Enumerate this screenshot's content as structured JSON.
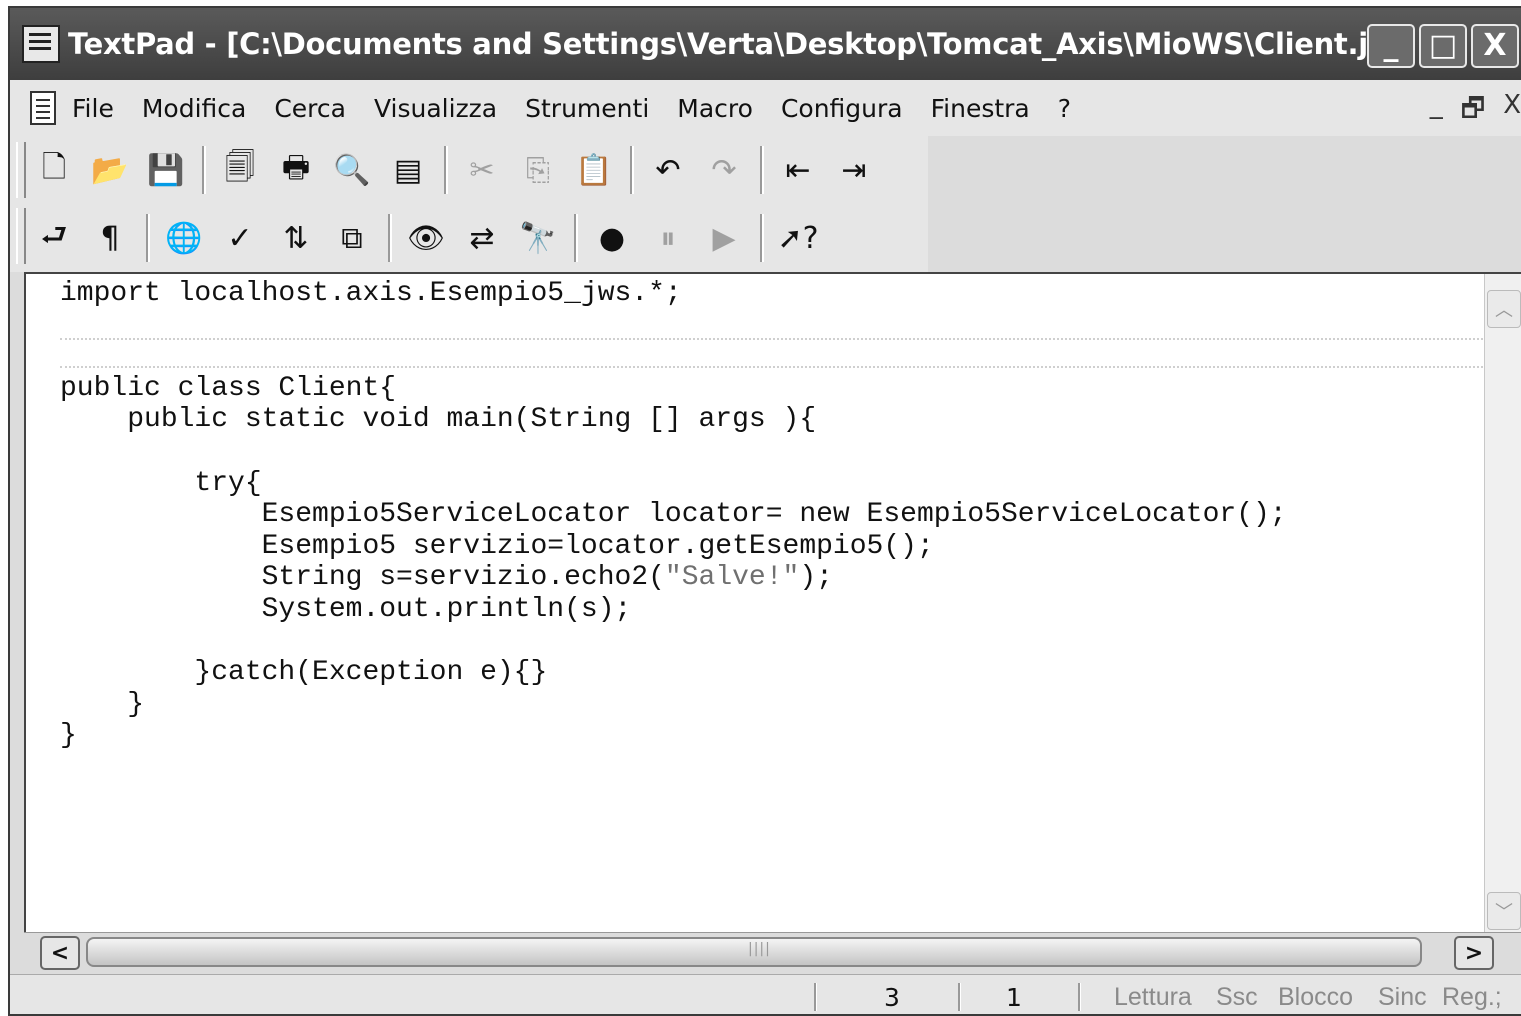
{
  "window": {
    "title": "TextPad - [C:\\Documents and Settings\\Verta\\Desktop\\Tomcat_Axis\\MioWS\\Client.j...",
    "buttons": [
      "_",
      "□",
      "X"
    ]
  },
  "menu": {
    "items": [
      "File",
      "Modifica",
      "Cerca",
      "Visualizza",
      "Strumenti",
      "Macro",
      "Configura",
      "Finestra",
      "?"
    ],
    "mdi_buttons": [
      "_",
      "🗗",
      "X"
    ]
  },
  "toolbar": {
    "row1": [
      {
        "name": "new-file-icon",
        "glyph": "🗋"
      },
      {
        "name": "open-folder-icon",
        "glyph": "📂"
      },
      {
        "name": "save-icon",
        "glyph": "💾",
        "disabled": true
      },
      {
        "sep": true
      },
      {
        "name": "document-properties-icon",
        "glyph": "🗐"
      },
      {
        "name": "print-icon",
        "glyph": "🖶"
      },
      {
        "name": "print-preview-icon",
        "glyph": "🔍"
      },
      {
        "name": "page-setup-icon",
        "glyph": "▤"
      },
      {
        "sep": true
      },
      {
        "name": "cut-icon",
        "glyph": "✂",
        "disabled": true
      },
      {
        "name": "copy-icon",
        "glyph": "⎘",
        "disabled": true
      },
      {
        "name": "paste-icon",
        "glyph": "📋"
      },
      {
        "sep": true
      },
      {
        "name": "undo-icon",
        "glyph": "↶"
      },
      {
        "name": "redo-icon",
        "glyph": "↷",
        "disabled": true
      },
      {
        "sep": true
      },
      {
        "name": "outdent-icon",
        "glyph": "⇤"
      },
      {
        "name": "indent-icon",
        "glyph": "⇥"
      }
    ],
    "row2": [
      {
        "name": "word-wrap-icon",
        "glyph": "⮐"
      },
      {
        "name": "paragraph-icon",
        "glyph": "¶"
      },
      {
        "sep": true
      },
      {
        "name": "web-browser-icon",
        "glyph": "🌐"
      },
      {
        "name": "spell-check-icon",
        "glyph": "✓"
      },
      {
        "name": "sort-icon",
        "glyph": "⇅"
      },
      {
        "name": "compare-icon",
        "glyph": "⧉"
      },
      {
        "sep": true
      },
      {
        "name": "find-icon",
        "glyph": "👁"
      },
      {
        "name": "replace-icon",
        "glyph": "⇄"
      },
      {
        "name": "find-in-files-icon",
        "glyph": "🔭"
      },
      {
        "sep": true
      },
      {
        "name": "record-macro-icon",
        "glyph": "●"
      },
      {
        "name": "pause-macro-icon",
        "glyph": "⏸",
        "disabled": true
      },
      {
        "name": "play-macro-icon",
        "glyph": "▶",
        "disabled": true
      },
      {
        "sep": true
      },
      {
        "name": "context-help-icon",
        "glyph": "➚?"
      }
    ]
  },
  "editor": {
    "lines": [
      {
        "text": "import localhost.axis.Esempio5_jws.*;",
        "row": 0
      },
      {
        "text": "public class Client{",
        "row": 3
      },
      {
        "text": "    public static void main(String [] args ){",
        "row": 4
      },
      {
        "text": "        try{",
        "row": 6
      },
      {
        "text": "            Esempio5ServiceLocator locator= new Esempio5ServiceLocator();",
        "row": 7
      },
      {
        "text": "            Esempio5 servizio=locator.getEsempio5();",
        "row": 8
      },
      {
        "pre": "            String s=servizio.echo2(",
        "str": "\"Salve!\"",
        "post": ");",
        "row": 9
      },
      {
        "text": "            System.out.println(s);",
        "row": 10
      },
      {
        "text": "        }catch(Exception e){}",
        "row": 12
      },
      {
        "text": "    }",
        "row": 13
      },
      {
        "text": "}",
        "row": 14
      }
    ]
  },
  "statusbar": {
    "line": "3",
    "column": "1",
    "indicators": [
      "Lettura",
      "Ssc",
      "Blocco",
      "Sinc",
      "Reg.;"
    ]
  }
}
